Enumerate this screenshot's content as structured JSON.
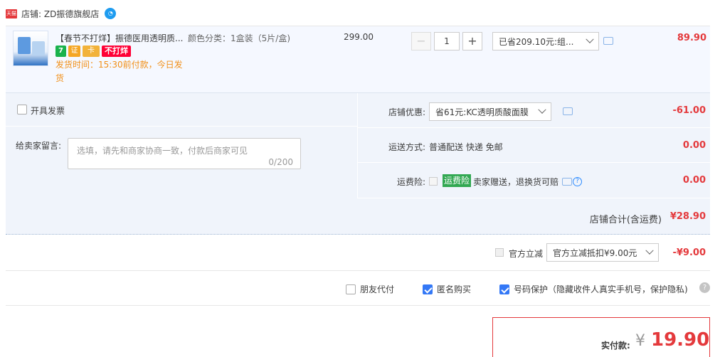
{
  "shop": {
    "tmall_badge": "天猫",
    "label": "店铺: ZD振德旗舰店",
    "wangwang_icon": "wangwang-chat-icon"
  },
  "item": {
    "title": "【春节不打烊】振德医用透明质...",
    "spec": "颜色分类：1盒装（5片/盒)",
    "badges": [
      "7",
      "证",
      "卡",
      "不打烊"
    ],
    "ship_time": "发货时间：15:30前付款，今日发货",
    "price": "299.00",
    "quantity": "1",
    "quantity_minus": "−",
    "quantity_plus": "+",
    "discount_select": "已省209.10元:组...",
    "subtotal": "89.90"
  },
  "extras": {
    "invoice_label": "开具发票",
    "message_label": "给卖家留言:",
    "message_placeholder": "选填，请先和商家协商一致，付款后商家可见",
    "message_count": "0/200",
    "shop_discount_label": "店铺优惠:",
    "shop_discount_select": "省61元:KC透明质酸面膜",
    "shop_discount_amount": "-61.00",
    "shipping_label": "运送方式:",
    "shipping_value": "普通配送 快递 免邮",
    "shipping_amount": "0.00",
    "insurance_label": "运费险:",
    "insurance_tag": "运费险",
    "insurance_text": "卖家赠送，退换货可赔",
    "insurance_amount": "0.00",
    "shop_total_label": "店铺合计(含运费)",
    "shop_total_amount": "¥28.90"
  },
  "gov": {
    "label": "官方立减",
    "select": "官方立减抵扣¥9.00元",
    "amount": "-¥9.00"
  },
  "options": {
    "friend_pay": "朋友代付",
    "anonymous": "匿名购买",
    "privacy": "号码保护（隐藏收件人真实手机号，保护隐私)",
    "help": "?"
  },
  "payment": {
    "label": "实付款:",
    "currency": "¥",
    "amount": "19.90"
  }
}
